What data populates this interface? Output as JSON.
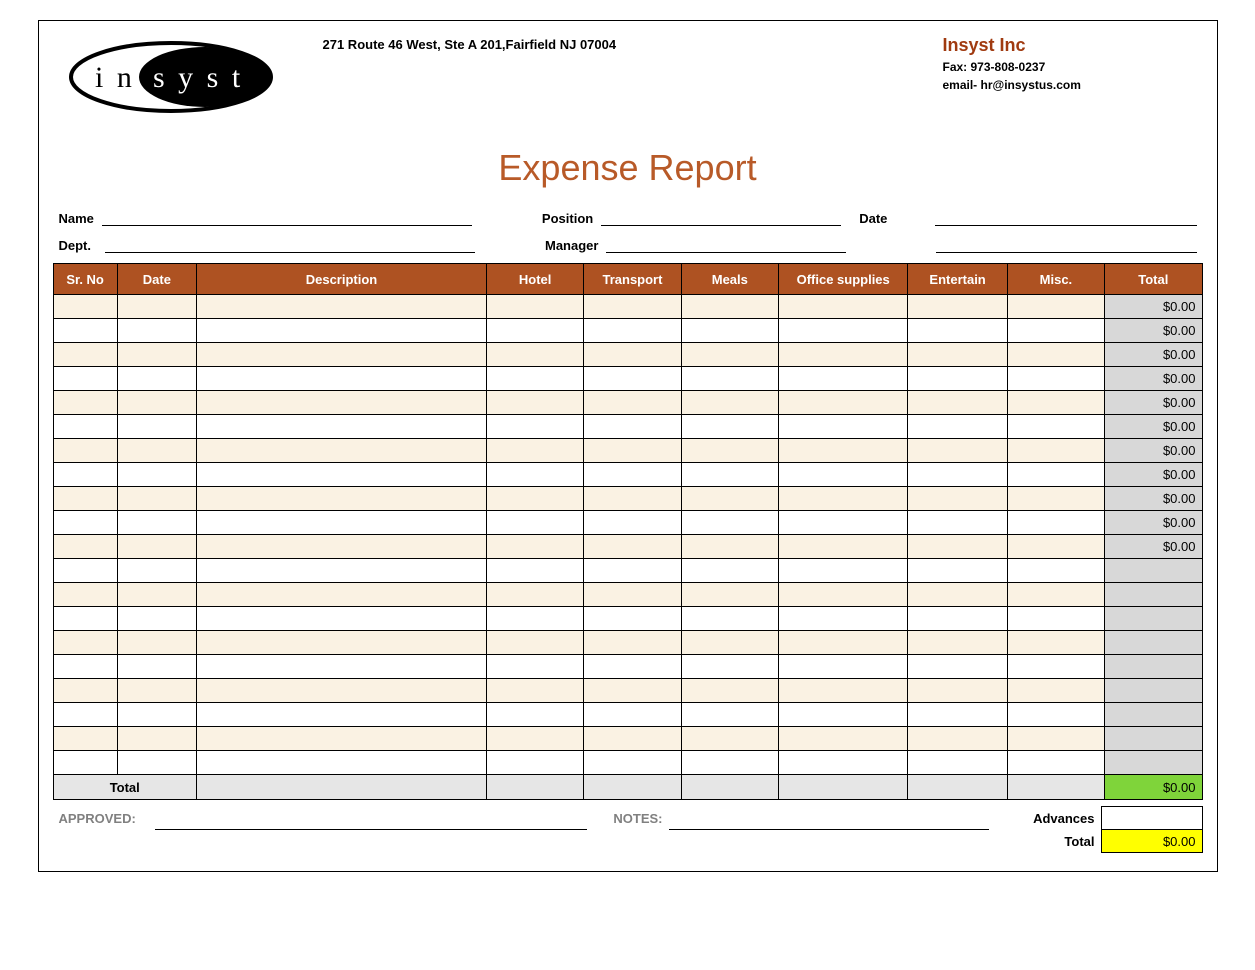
{
  "header": {
    "address": "271 Route 46 West, Ste A 201,Fairfield NJ 07004",
    "company_name": "Insyst Inc",
    "fax": "Fax: 973-808-0237",
    "email": "email- hr@insystus.com",
    "logo_text": "insyst"
  },
  "title": "Expense Report",
  "info": {
    "name_label": "Name",
    "dept_label": "Dept.",
    "position_label": "Position",
    "manager_label": "Manager",
    "date_label": "Date"
  },
  "columns": {
    "srno": "Sr. No",
    "date": "Date",
    "description": "Description",
    "hotel": "Hotel",
    "transport": "Transport",
    "meals": "Meals",
    "office_supplies": "Office supplies",
    "entertain": "Entertain",
    "misc": "Misc.",
    "total": "Total"
  },
  "rows": [
    {
      "total": "$0.00"
    },
    {
      "total": "$0.00"
    },
    {
      "total": "$0.00"
    },
    {
      "total": "$0.00"
    },
    {
      "total": "$0.00"
    },
    {
      "total": "$0.00"
    },
    {
      "total": "$0.00"
    },
    {
      "total": "$0.00"
    },
    {
      "total": "$0.00"
    },
    {
      "total": "$0.00"
    },
    {
      "total": "$0.00"
    },
    {
      "total": ""
    },
    {
      "total": ""
    },
    {
      "total": ""
    },
    {
      "total": ""
    },
    {
      "total": ""
    },
    {
      "total": ""
    },
    {
      "total": ""
    },
    {
      "total": ""
    },
    {
      "total": ""
    }
  ],
  "totals": {
    "row_label": "Total",
    "grand_total": "$0.00",
    "approved_label": "APPROVED:",
    "notes_label": "NOTES:",
    "advances_label": "Advances",
    "final_total_label": "Total",
    "final_total_value": "$0.00"
  }
}
